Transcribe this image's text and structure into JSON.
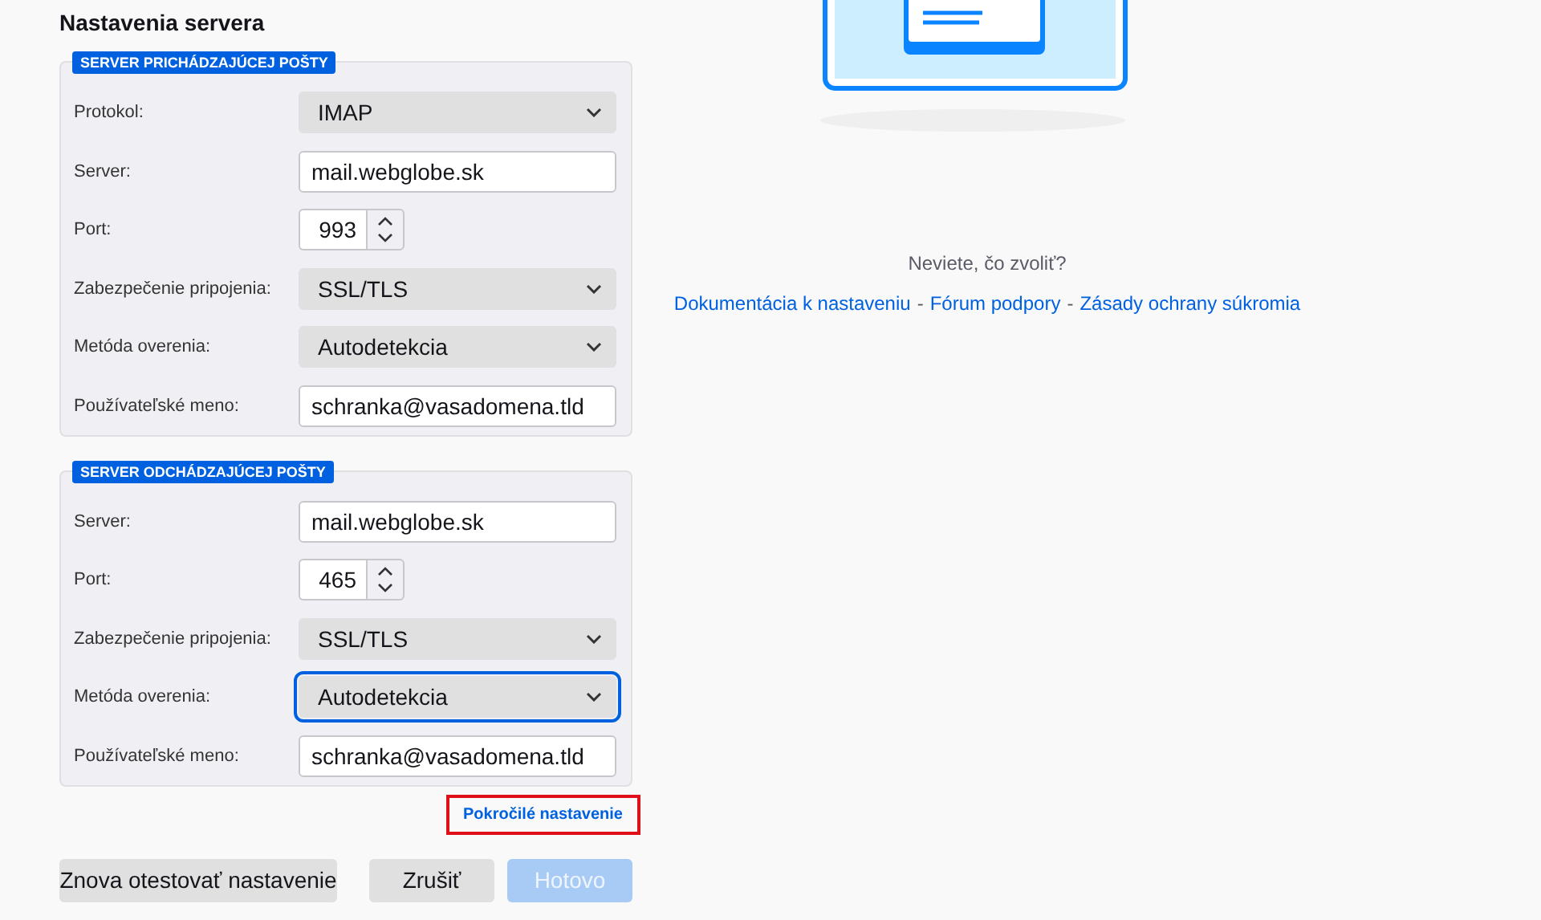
{
  "title": "Nastavenia servera",
  "groups": [
    {
      "legend": "SERVER PRICHÁDZAJÚCEJ POŠTY",
      "fields": [
        {
          "kind": "select",
          "label": "Protokol:",
          "value": "IMAP",
          "focused": false
        },
        {
          "kind": "text",
          "label": "Server:",
          "value": "mail.webglobe.sk"
        },
        {
          "kind": "spin",
          "label": "Port:",
          "value": "993"
        },
        {
          "kind": "select",
          "label": "Zabezpečenie pripojenia:",
          "value": "SSL/TLS",
          "focused": false
        },
        {
          "kind": "select",
          "label": "Metóda overenia:",
          "value": "Autodetekcia",
          "focused": false
        },
        {
          "kind": "text",
          "label": "Používateľské meno:",
          "value": "schranka@vasadomena.tld"
        }
      ]
    },
    {
      "legend": "SERVER ODCHÁDZAJÚCEJ POŠTY",
      "fields": [
        {
          "kind": "text",
          "label": "Server:",
          "value": "mail.webglobe.sk"
        },
        {
          "kind": "spin",
          "label": "Port:",
          "value": "465"
        },
        {
          "kind": "select",
          "label": "Zabezpečenie pripojenia:",
          "value": "SSL/TLS",
          "focused": false
        },
        {
          "kind": "select",
          "label": "Metóda overenia:",
          "value": "Autodetekcia",
          "focused": true
        },
        {
          "kind": "text",
          "label": "Používateľské meno:",
          "value": "schranka@vasadomena.tld"
        }
      ]
    }
  ],
  "advanced_link": {
    "label": "Pokročilé nastavenie",
    "highlighted": true
  },
  "buttons": [
    {
      "label": "Znova otestovať nastavenie",
      "disabled": false
    },
    {
      "label": "Zrušiť",
      "disabled": false
    },
    {
      "label": "Hotovo",
      "disabled": true
    }
  ],
  "help": {
    "question": "Neviete, čo zvoliť?",
    "links": [
      "Dokumentácia k nastaveniu",
      "Fórum podpory",
      "Zásady ochrany súkromia"
    ],
    "separator": "-"
  }
}
